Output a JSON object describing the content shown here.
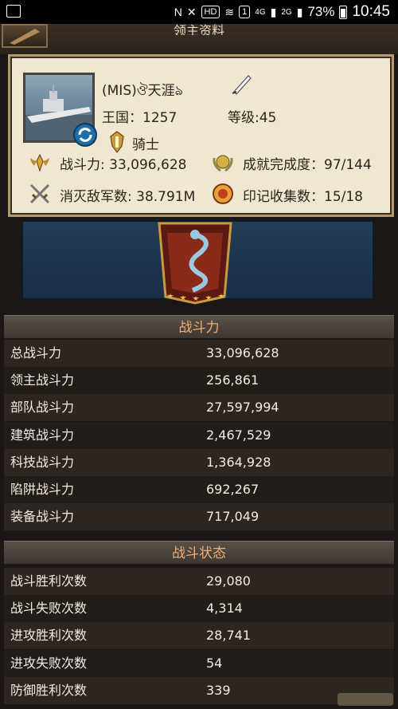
{
  "status_bar": {
    "hd": "HD",
    "network": "4G",
    "network2": "2G",
    "sim": "1",
    "battery": "73%",
    "time": "10:45"
  },
  "header": {
    "title": "领主资料"
  },
  "profile": {
    "name": "(MIS)ঔ天涯ঌ",
    "kingdom": "王国：1257",
    "level": "等级:45",
    "rank": "骑士",
    "power": "战斗力: 33,096,628",
    "achievement": "成就完成度：97/144",
    "kills": "消灭敌军数: 38.791M",
    "seals": "印记收集数：15/18"
  },
  "sections": {
    "power": {
      "title": "战斗力",
      "rows": [
        {
          "label": "总战斗力",
          "value": "33,096,628"
        },
        {
          "label": "领主战斗力",
          "value": "256,861"
        },
        {
          "label": "部队战斗力",
          "value": "27,597,994"
        },
        {
          "label": "建筑战斗力",
          "value": "2,467,529"
        },
        {
          "label": "科技战斗力",
          "value": "1,364,928"
        },
        {
          "label": "陷阱战斗力",
          "value": "692,267"
        },
        {
          "label": "装备战斗力",
          "value": "717,049"
        }
      ]
    },
    "battle": {
      "title": "战斗状态",
      "rows": [
        {
          "label": "战斗胜利次数",
          "value": "29,080"
        },
        {
          "label": "战斗失败次数",
          "value": "4,314"
        },
        {
          "label": "进攻胜利次数",
          "value": "28,741"
        },
        {
          "label": "进攻失败次数",
          "value": "54"
        },
        {
          "label": "防御胜利次数",
          "value": "339"
        }
      ]
    }
  },
  "colors": {
    "section_title": "#f0b070",
    "card_bg": "#f0e6d2",
    "banner_bg": "#233c58"
  }
}
